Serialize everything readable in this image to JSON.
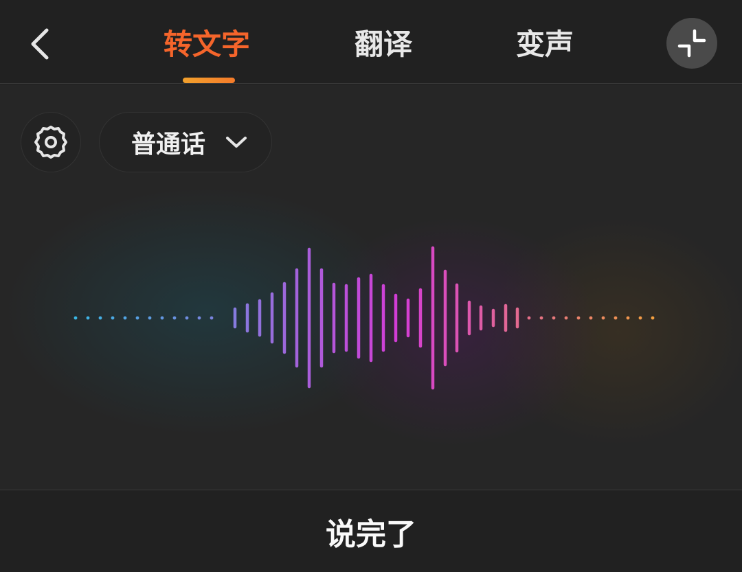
{
  "header": {
    "tabs": [
      {
        "label": "转文字",
        "active": true
      },
      {
        "label": "翻译",
        "active": false
      },
      {
        "label": "变声",
        "active": false
      }
    ]
  },
  "toolbar": {
    "language": "普通话"
  },
  "footer": {
    "done_label": "说完了"
  },
  "colors": {
    "accent": "#f5652b",
    "wave_start": "#3ab8e6",
    "wave_mid": "#d43cd6",
    "wave_end": "#f6a43a"
  },
  "icons": {
    "back": "chevron-left-icon",
    "minimize": "minimize-icon",
    "settings": "gear-icon",
    "dropdown": "chevron-down-icon"
  }
}
